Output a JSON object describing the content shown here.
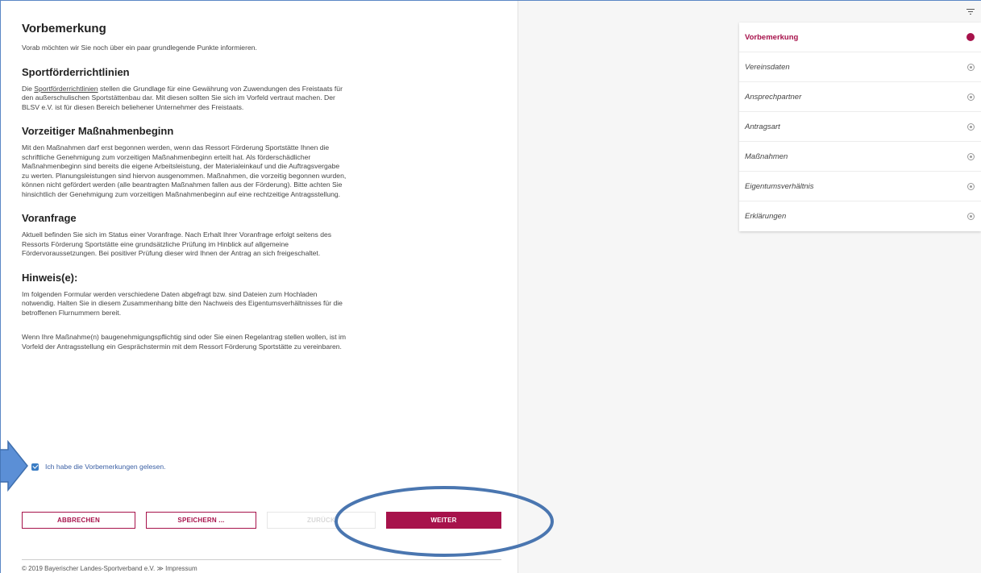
{
  "main": {
    "title": "Vorbemerkung",
    "intro": "Vorab möchten wir Sie noch über ein paar grundlegende Punkte informieren.",
    "sections": [
      {
        "heading": "Sportförderrichtlinien",
        "link_text": "Sportförderrichtlinien",
        "text_before_link": "Die ",
        "text_after_link": " stellen die Grundlage für eine Gewährung von Zuwendungen des Freistaats für den außerschulischen Sportstättenbau dar. Mit diesen sollten Sie sich im Vorfeld vertraut machen. Der BLSV e.V. ist für diesen Bereich beliehener Unternehmer des Freistaats."
      },
      {
        "heading": "Vorzeitiger Maßnahmenbeginn",
        "paragraph": "Mit den Maßnahmen darf erst begonnen werden, wenn das Ressort Förderung Sportstätte Ihnen die schriftliche Genehmigung zum vorzeitigen Maßnahmenbeginn erteilt hat. Als förderschädlicher Maßnahmenbeginn sind bereits die eigene Arbeitsleistung, der Materialeinkauf und die Auftragsvergabe zu werten. Planungsleistungen sind hiervon ausgenommen. Maßnahmen, die vorzeitig begonnen wurden, können nicht gefördert werden (alle beantragten Maßnahmen fallen aus der Förderung). Bitte achten Sie hinsichtlich der Genehmigung zum vorzeitigen Maßnahmenbeginn auf eine rechtzeitige Antragsstellung."
      },
      {
        "heading": "Voranfrage",
        "paragraph": "Aktuell befinden Sie sich im Status einer Voranfrage. Nach Erhalt Ihrer Voranfrage erfolgt seitens des Ressorts Förderung Sportstätte eine grundsätzliche Prüfung im Hinblick auf allgemeine Fördervoraussetzungen. Bei positiver Prüfung dieser wird Ihnen der Antrag an sich freigeschaltet."
      },
      {
        "heading": "Hinweis(e):",
        "paragraph1": "Im folgenden Formular werden verschiedene Daten abgefragt bzw. sind Dateien zum Hochladen notwendig. Halten Sie in diesem Zusammenhang bitte den Nachweis des Eigentumsverhältnisses für die betroffenen Flurnummern bereit.",
        "paragraph2": "Wenn Ihre Maßnahme(n) baugenehmigungspflichtig sind oder Sie einen Regelantrag stellen wollen, ist im Vorfeld der Antragsstellung ein Gesprächstermin mit dem Ressort Förderung Sportstätte zu vereinbaren."
      }
    ],
    "checkbox_label": "Ich habe die Vorbemerkungen gelesen.",
    "checkbox_checked": true
  },
  "buttons": {
    "cancel": "ABBRECHEN",
    "save": "SPEICHERN ...",
    "back": "ZURÜCK",
    "next": "WEITER"
  },
  "footer": {
    "copyright": "© 2019 Bayerischer Landes-Sportverband e.V.",
    "separator": "≫",
    "imprint": "Impressum"
  },
  "nav": {
    "items": [
      {
        "label": "Vorbemerkung",
        "active": true
      },
      {
        "label": "Vereinsdaten",
        "active": false
      },
      {
        "label": "Ansprechpartner",
        "active": false
      },
      {
        "label": "Antragsart",
        "active": false
      },
      {
        "label": "Maßnahmen",
        "active": false
      },
      {
        "label": "Eigentumsverhältnis",
        "active": false
      },
      {
        "label": "Erklärungen",
        "active": false
      }
    ]
  },
  "colors": {
    "accent": "#a7124b",
    "annotation": "#4a76b0"
  },
  "icons": {
    "filter": "filter-icon",
    "checkbox": "checkbox-checked-icon",
    "annotation_arrow": "arrow-right-icon"
  }
}
